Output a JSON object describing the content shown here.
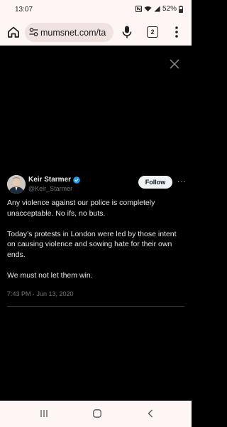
{
  "status_bar": {
    "time": "13:07",
    "battery": "52%"
  },
  "browser": {
    "url": "mumsnet.com/ta",
    "tab_count": "2"
  },
  "tweet": {
    "author_name": "Keir Starmer",
    "author_handle": "@Keir_Starmer",
    "follow_label": "Follow",
    "more_label": "···",
    "paragraphs": [
      "Any violence against our police is completely unacceptable. No ifs, no buts.",
      "Today’s protests in London were led by those intent on causing violence and sowing hate for their own ends.",
      "We must not let them win."
    ],
    "timestamp": "7:43 PM · Jun 13, 2020"
  },
  "colors": {
    "background": "#000000",
    "chrome": "#fdf6f4",
    "url_pill": "#f0e2de",
    "verified": "#1d9bf0",
    "text_primary": "#e7e9ea",
    "text_secondary": "#71767b"
  },
  "icons": {
    "home": "home-icon",
    "site_settings": "tune-icon",
    "mic": "mic-icon",
    "tabs": "tabs-icon",
    "menu": "more-vert-icon",
    "close": "close-icon",
    "verified": "verified-badge-icon",
    "nav_recents": "recents-icon",
    "nav_home": "nav-home-icon",
    "nav_back": "back-icon"
  }
}
